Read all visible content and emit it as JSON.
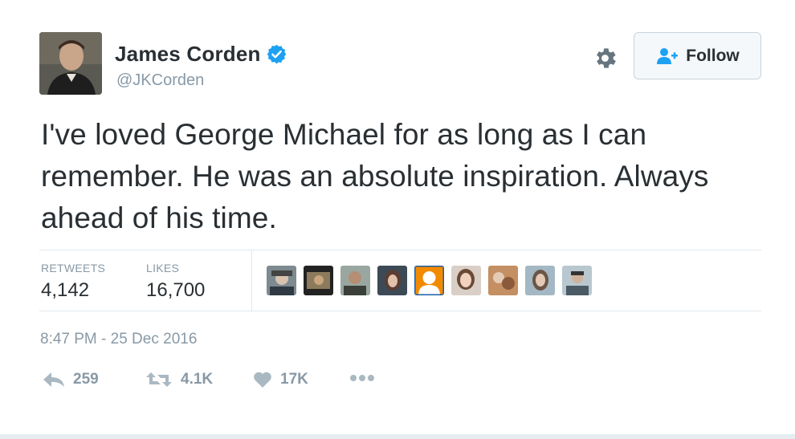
{
  "user": {
    "name": "James Corden",
    "handle": "@JKCorden"
  },
  "follow_button": {
    "label": "Follow"
  },
  "tweet": {
    "text": "I've loved George Michael for as long as I can remember. He was an absolute inspiration. Always ahead of his time."
  },
  "stats": {
    "retweets_label": "RETWEETS",
    "retweets_value": "4,142",
    "likes_label": "LIKES",
    "likes_value": "16,700"
  },
  "liker_avatars_count": 9,
  "timestamp": "8:47 PM - 25 Dec 2016",
  "actions": {
    "reply_count": "259",
    "retweet_count": "4.1K",
    "like_count": "17K"
  },
  "colors": {
    "verified": "#1da1f2",
    "follow_icon": "#1da1f2",
    "muted": "#8899a6",
    "text": "#292f33"
  },
  "icons": {
    "verified": "verified-badge-icon",
    "settings": "gear-icon",
    "follow": "add-person-icon",
    "reply": "reply-icon",
    "retweet": "retweet-icon",
    "like": "heart-icon",
    "more": "more-dots-icon"
  }
}
